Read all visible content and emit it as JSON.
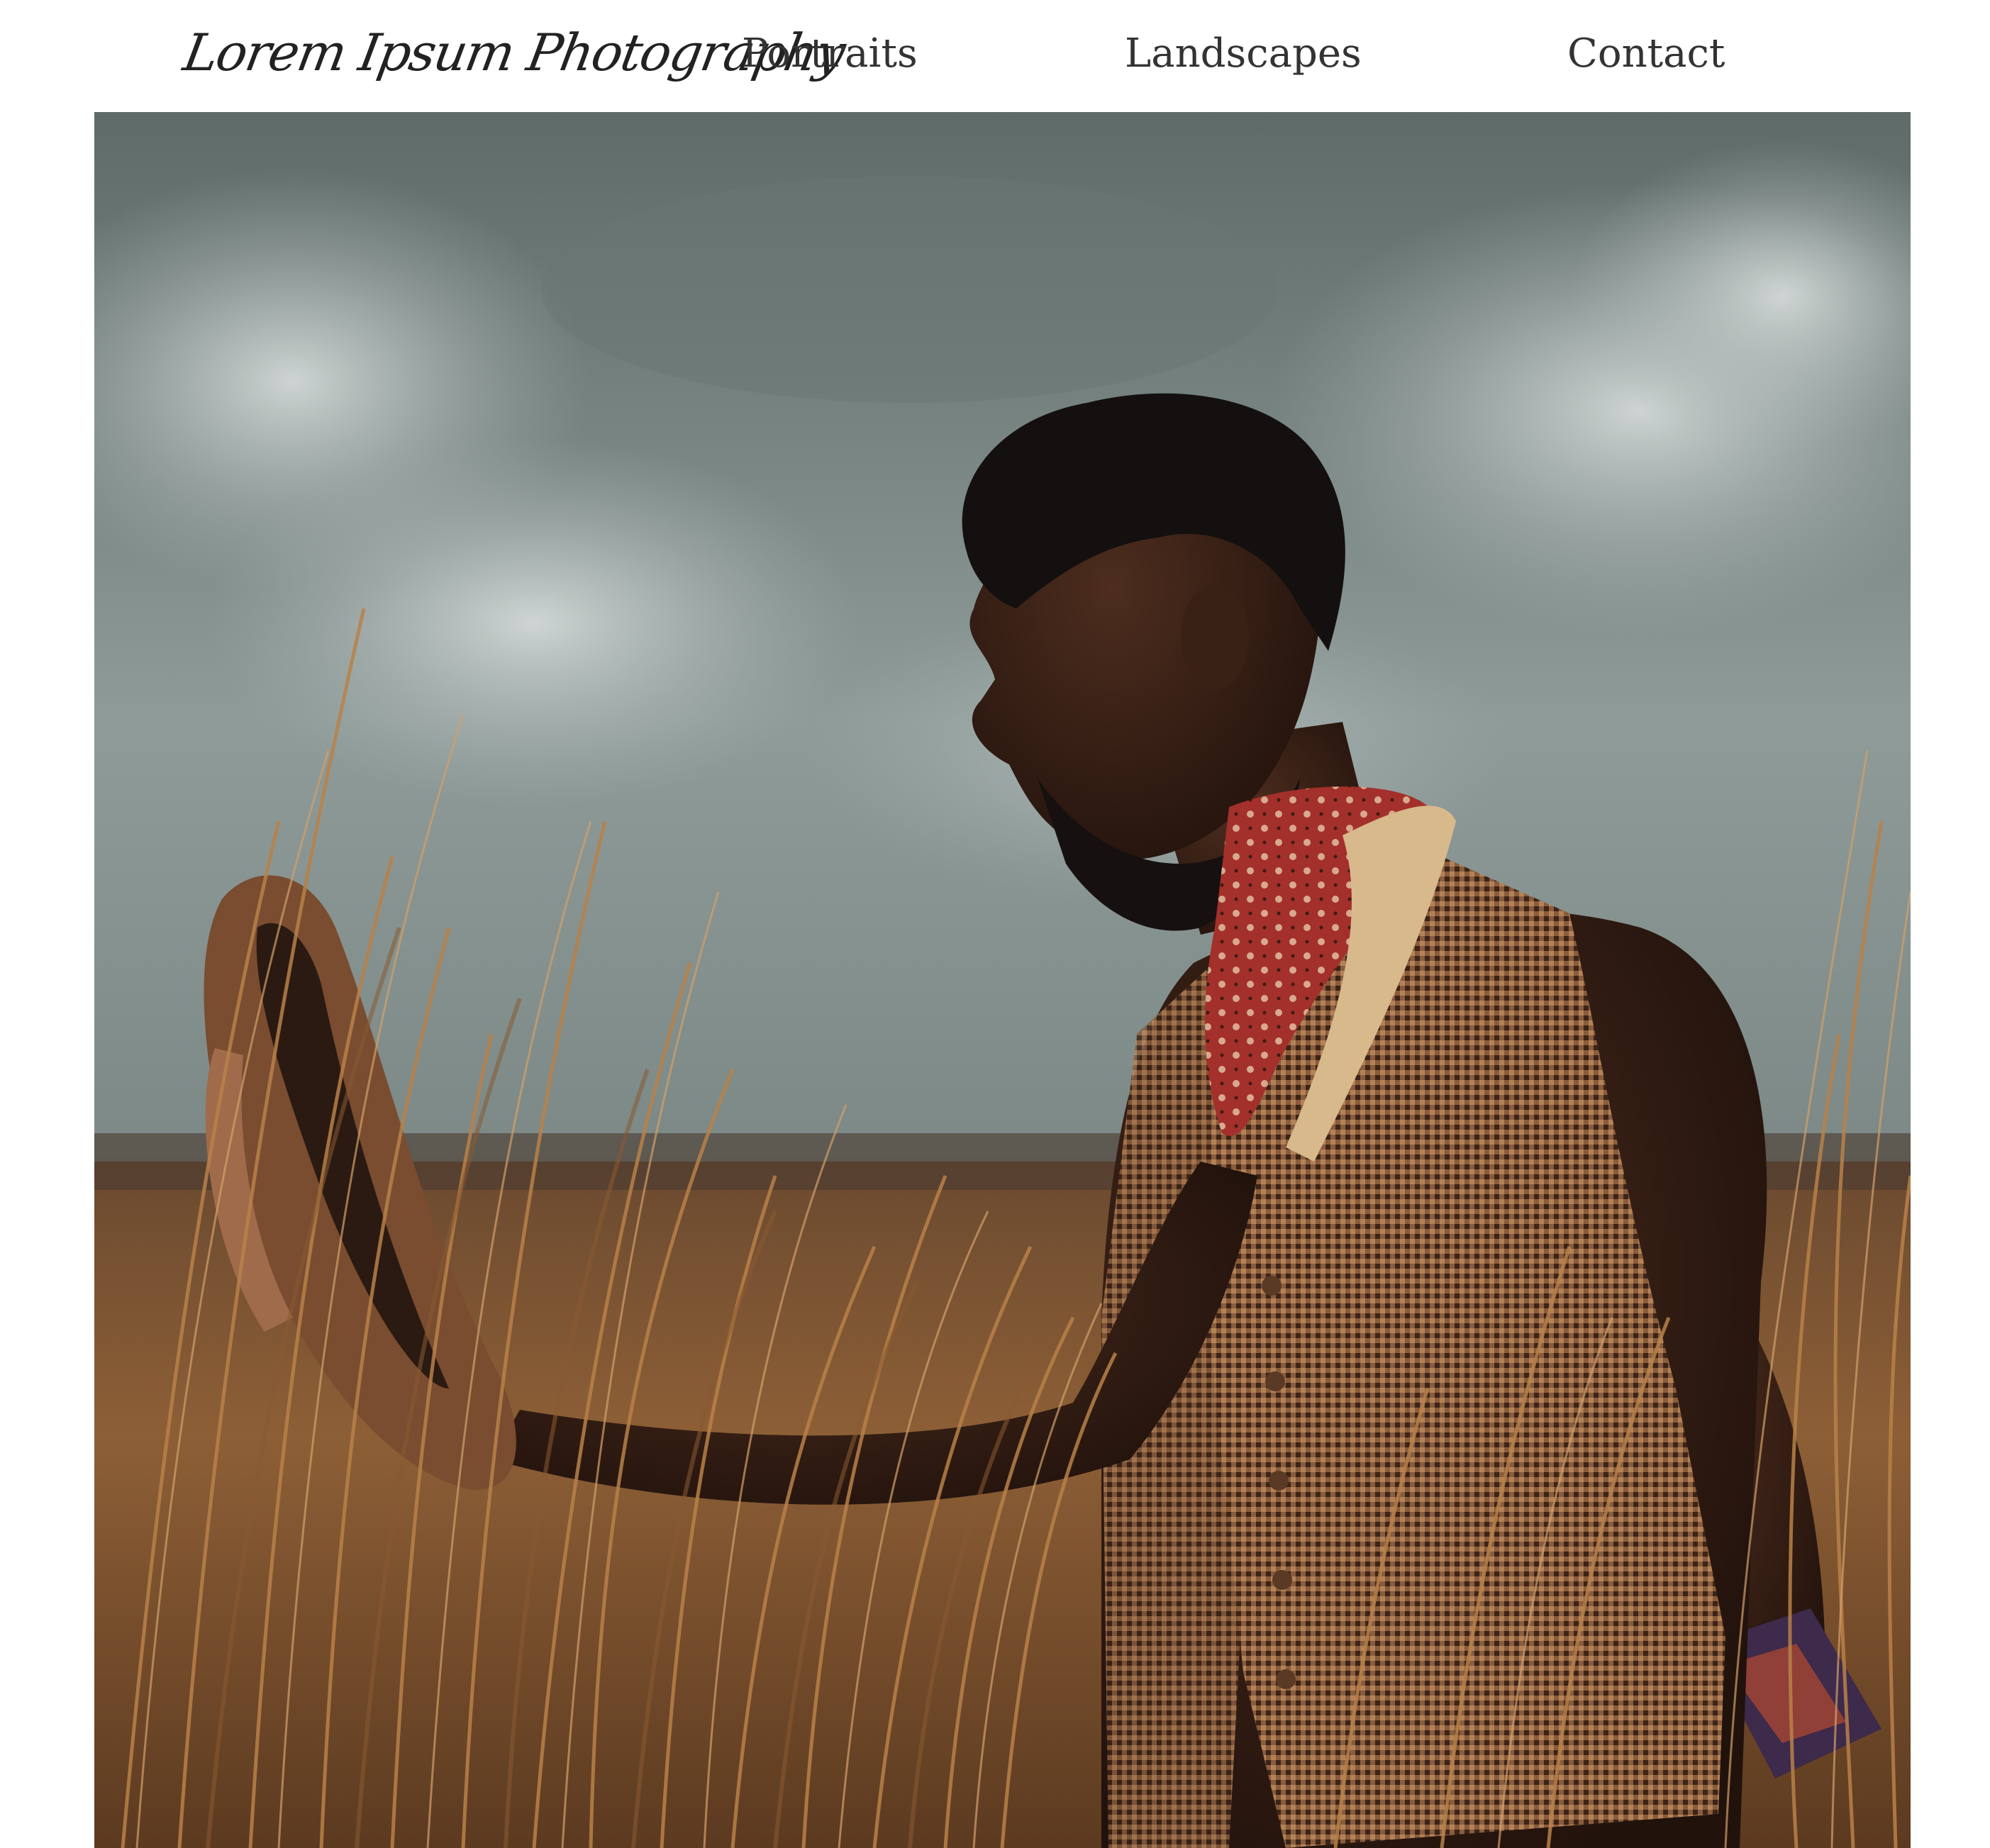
{
  "site": {
    "logo_text": "Lorem Ipsum Photography"
  },
  "nav": {
    "items": [
      {
        "label": "Portraits"
      },
      {
        "label": "Landscapes"
      },
      {
        "label": "Contact"
      }
    ]
  },
  "hero": {
    "subject": "portrait-photo",
    "colors": {
      "sky": "#8b9896",
      "cloud": "#c4cccb",
      "grass": "#a9743f",
      "skin": "#3a2116",
      "vest": "#7a4f33",
      "bandana": "#a3302a",
      "hat": "#8a5a3c"
    }
  }
}
